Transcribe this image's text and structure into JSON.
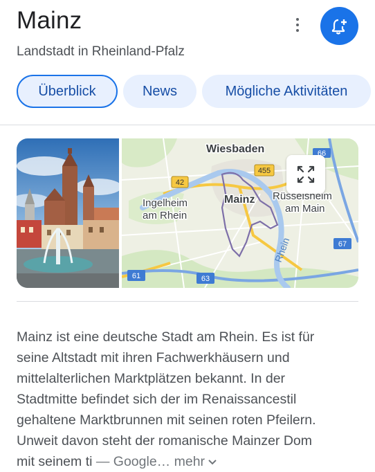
{
  "header": {
    "title": "Mainz",
    "subtitle": "Landstadt in Rheinland-Pfalz"
  },
  "tabs": [
    {
      "label": "Überblick",
      "active": true
    },
    {
      "label": "News",
      "active": false
    },
    {
      "label": "Mögliche Aktivitäten",
      "active": false
    }
  ],
  "map": {
    "labels": {
      "wiesbaden": "Wiesbaden",
      "mainz": "Mainz",
      "ingelheim_1": "Ingelheim",
      "ingelheim_2": "am Rhein",
      "ruesselsheim_1": "Rüsselsheim",
      "ruesselsheim_2": "am Main",
      "river": "Rhein"
    },
    "road_shields": [
      "42",
      "455",
      "66",
      "67",
      "61",
      "63"
    ]
  },
  "description": {
    "lines": [
      "Mainz ist eine deutsche Stadt am Rhein. Es ist für",
      "seine Altstadt mit ihren Fachwerkhäusern und",
      "mittelalterlichen Marktplätzen bekannt. In der",
      "Stadtmitte befindet sich der im Renaissancestil",
      "gehaltene Marktbrunnen mit seinen roten Pfeilern.",
      "Unweit davon steht der romanische Mainzer Dom"
    ],
    "last_line": "mit seinem ti",
    "source": "— Google…",
    "more": "mehr"
  },
  "colors": {
    "accent": "#1a73e8",
    "tab_bg": "#e8f0fe",
    "highway": "#f6c842",
    "autobahn": "#3e7bd3"
  },
  "icons": [
    "more-vert-icon",
    "add-alert-icon",
    "fullscreen-icon",
    "chevron-down-icon"
  ]
}
